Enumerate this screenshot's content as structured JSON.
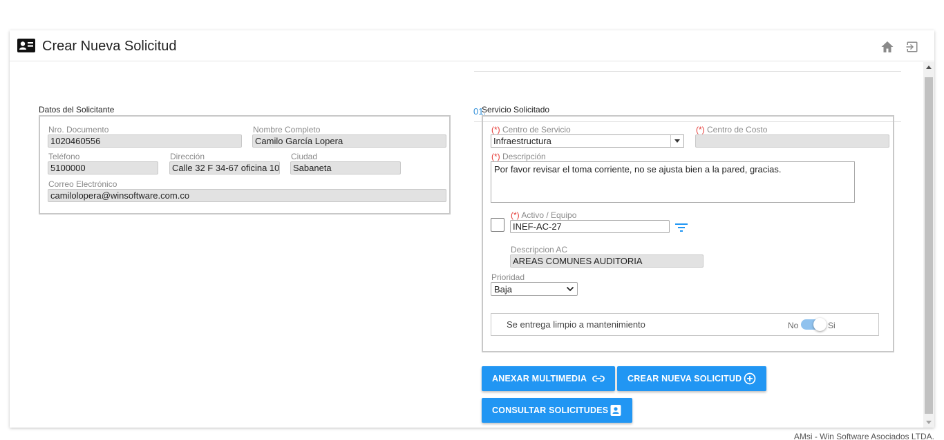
{
  "header": {
    "title": "Crear Nueva Solicitud",
    "home_icon": "home-icon",
    "exit_icon": "exit-icon",
    "title_icon": "id-card-icon"
  },
  "top_fragment": "01.",
  "solicitante": {
    "legend": "Datos del Solicitante",
    "documento": {
      "label": "Nro. Documento",
      "value": "1020460556"
    },
    "nombre": {
      "label": "Nombre Completo",
      "value": "Camilo García Lopera"
    },
    "telefono": {
      "label": "Teléfono",
      "value": "5100000"
    },
    "direccion": {
      "label": "Dirección",
      "value": "Calle 32 F 34-67 oficina 10"
    },
    "ciudad": {
      "label": "Ciudad",
      "value": "Sabaneta"
    },
    "correo": {
      "label": "Correo Electrónico",
      "value": "camilolopera@winsoftware.com.co"
    }
  },
  "servicio": {
    "legend": "Servicio Solicitado",
    "required_mark": "(*)",
    "centro_servicio": {
      "label": "Centro de Servicio",
      "value": "Infraestructura"
    },
    "centro_costo": {
      "label": "Centro de Costo",
      "value": ""
    },
    "descripcion": {
      "label": "Descripción",
      "value": "Por favor revisar el toma corriente, no se ajusta bien a la pared, gracias."
    },
    "activo": {
      "label": "Activo / Equipo",
      "value": "INEF-AC-27"
    },
    "descripcion_ac": {
      "label": "Descripcion AC",
      "value": "AREAS COMUNES AUDITORIA"
    },
    "prioridad": {
      "label": "Prioridad",
      "value": "Baja"
    },
    "entrega": {
      "label": "Se entrega limpio a mantenimiento",
      "no": "No",
      "si": "Si",
      "checked": true
    }
  },
  "buttons": {
    "anexar": "ANEXAR MULTIMEDIA",
    "crear": "CREAR NUEVA SOLICITUD",
    "consultar": "CONSULTAR SOLICITUDES"
  },
  "colors": {
    "primary": "#2196f3",
    "required": "#e53935",
    "toggle_track": "#90c2ee"
  },
  "footer": "AMsi - Win Software Asociados LTDA."
}
